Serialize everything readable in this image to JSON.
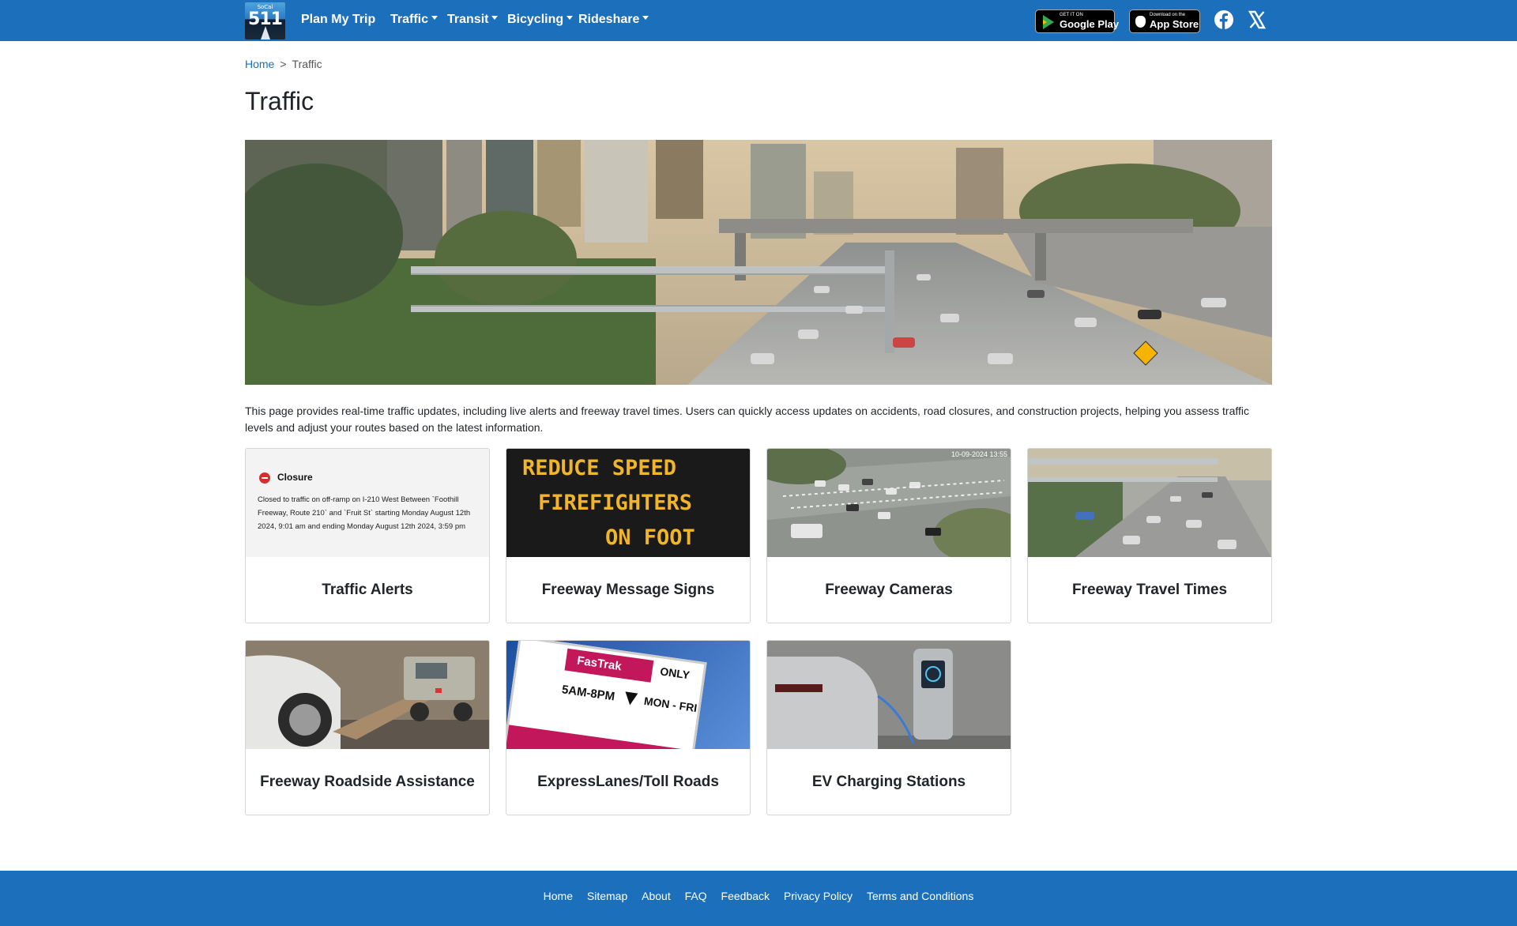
{
  "header": {
    "logo_top": "SoCal",
    "logo_number": "511",
    "nav": {
      "plan_my_trip": "Plan My Trip",
      "traffic": "Traffic",
      "transit": "Transit",
      "bicycling": "Bicycling",
      "rideshare": "Rideshare"
    },
    "google_play": {
      "small": "GET IT ON",
      "big": "Google Play"
    },
    "app_store": {
      "small": "Download on the",
      "big": "App Store"
    },
    "brand_color": "#1b6fbb"
  },
  "breadcrumb": {
    "home": "Home",
    "separator": ">",
    "current": "Traffic"
  },
  "page_title": "Traffic",
  "intro_text": "This page provides real-time traffic updates, including live alerts and freeway travel times. Users can quickly access updates on accidents, road closures, and construction projects, helping you assess traffic levels and adjust your routes based on the latest information.",
  "cards": {
    "traffic_alerts": {
      "title": "Traffic Alerts",
      "alert_type": "Closure",
      "alert_text": "Closed to traffic on off-ramp on I-210 West Between `Foothill Freeway, Route 210` and `Fruit St` starting Monday August 12th 2024, 9:01 am and ending Monday August 12th 2024, 3:59 pm"
    },
    "message_signs": {
      "title": "Freeway Message Signs",
      "sign_line1": "REDUCE SPEED",
      "sign_line2": "FIREFIGHTERS",
      "sign_line3": "ON FOOT"
    },
    "cameras": {
      "title": "Freeway Cameras",
      "timestamp": "10-09-2024 13:55"
    },
    "travel_times": {
      "title": "Freeway Travel Times"
    },
    "roadside": {
      "title": "Freeway Roadside Assistance"
    },
    "expresslanes": {
      "title": "ExpressLanes/Toll Roads",
      "sign_brand": "FasTrak",
      "sign_only": "ONLY",
      "sign_hours": "5AM-8PM",
      "sign_days": "MON - FRI"
    },
    "ev": {
      "title": "EV Charging Stations"
    }
  },
  "footer": {
    "home": "Home",
    "sitemap": "Sitemap",
    "about": "About",
    "faq": "FAQ",
    "feedback": "Feedback",
    "privacy": "Privacy Policy",
    "terms": "Terms and Conditions"
  }
}
